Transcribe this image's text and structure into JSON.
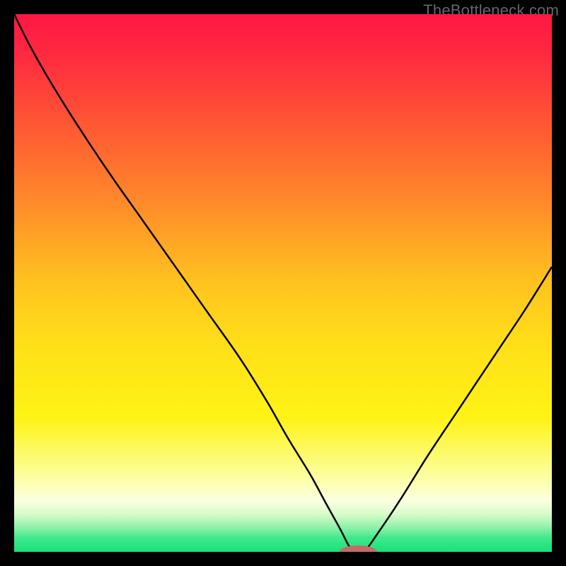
{
  "watermark": "TheBottleneck.com",
  "chart_data": {
    "type": "line",
    "title": "",
    "xlabel": "",
    "ylabel": "",
    "x_range": [
      0,
      100
    ],
    "y_range": [
      0,
      100
    ],
    "gradient_stops": [
      {
        "offset": 0.0,
        "color": "#ff1744"
      },
      {
        "offset": 0.08,
        "color": "#ff2b3f"
      },
      {
        "offset": 0.2,
        "color": "#ff5534"
      },
      {
        "offset": 0.35,
        "color": "#ff8a2a"
      },
      {
        "offset": 0.5,
        "color": "#ffc31f"
      },
      {
        "offset": 0.62,
        "color": "#ffe018"
      },
      {
        "offset": 0.75,
        "color": "#fff315"
      },
      {
        "offset": 0.86,
        "color": "#fcffa0"
      },
      {
        "offset": 0.905,
        "color": "#fbffe0"
      },
      {
        "offset": 0.93,
        "color": "#d7fbc9"
      },
      {
        "offset": 0.955,
        "color": "#8ef0a8"
      },
      {
        "offset": 0.975,
        "color": "#3ee88c"
      },
      {
        "offset": 1.0,
        "color": "#15e37a"
      }
    ],
    "series": [
      {
        "name": "bottleneck-curve",
        "color": "#000000",
        "stroke_width": 2.5,
        "x": [
          0.0,
          3.0,
          7.0,
          12.0,
          18.0,
          24.0,
          30.0,
          36.0,
          42.0,
          47.0,
          51.0,
          55.0,
          58.0,
          60.5,
          63.0,
          65.0,
          68.0,
          72.0,
          77.0,
          83.0,
          90.0,
          95.0,
          100.0
        ],
        "y": [
          100.0,
          94.0,
          87.0,
          79.0,
          70.0,
          61.5,
          53.0,
          44.5,
          36.0,
          28.0,
          21.0,
          14.5,
          9.0,
          4.5,
          0.0,
          0.0,
          4.0,
          10.0,
          18.0,
          27.0,
          37.5,
          45.0,
          53.0
        ]
      }
    ],
    "marker": {
      "x": 64.0,
      "y": 0.0,
      "rx": 3.5,
      "ry": 1.2,
      "color": "#c96a6a"
    }
  }
}
